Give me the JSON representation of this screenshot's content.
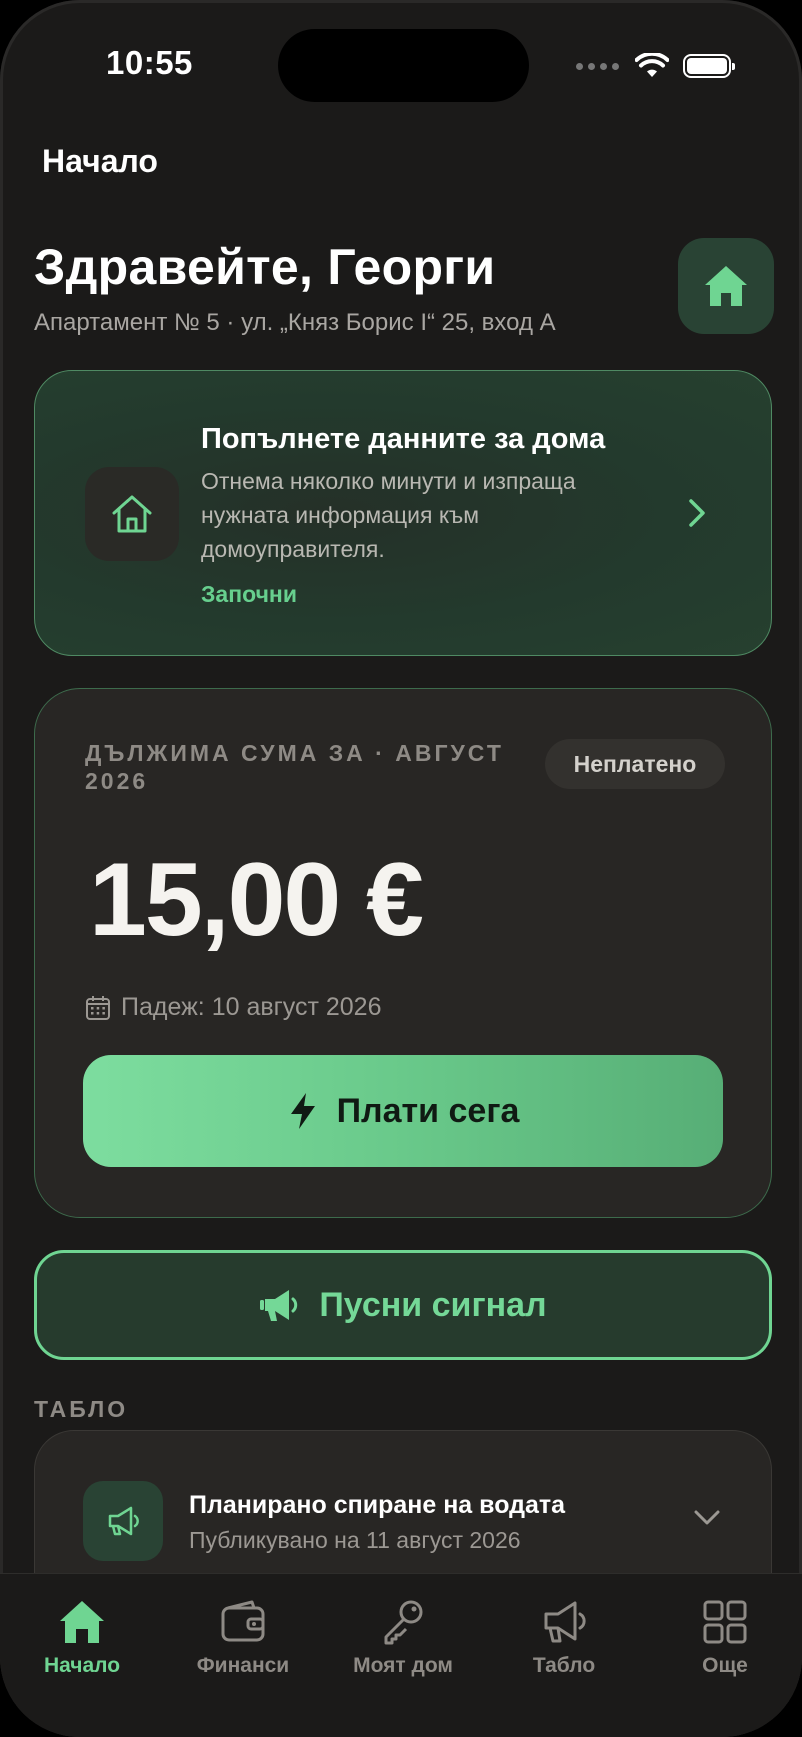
{
  "status_bar": {
    "time": "10:55"
  },
  "nav": {
    "title": "Начало"
  },
  "header": {
    "greeting": "Здравейте, Георги",
    "address": "Апартамент № 5 · ул. „Княз Борис I“ 25, вход А"
  },
  "onboarding": {
    "title": "Попълнете данните за дома",
    "description": "Отнема няколко минути и изпраща нужната информация към домоуправителя.",
    "cta": "Започни"
  },
  "due": {
    "label": "ДЪЛЖИМА СУМА ЗА · АВГУСТ 2026",
    "status": "Неплатено",
    "amount": "15,00 €",
    "due_date": "Падеж: 10 август 2026",
    "pay_button": "Плати сега"
  },
  "signal_button": "Пусни сигнал",
  "board": {
    "section_title": "ТАБЛО",
    "items": [
      {
        "title": "Планирано спиране на водата",
        "subtitle": "Публикувано на 11 август 2026",
        "icon": "megaphone-icon"
      }
    ]
  },
  "tabbar": {
    "items": [
      {
        "label": "Начало",
        "icon": "home-icon",
        "active": true
      },
      {
        "label": "Финанси",
        "icon": "wallet-icon",
        "active": false
      },
      {
        "label": "Моят дом",
        "icon": "key-icon",
        "active": false
      },
      {
        "label": "Табло",
        "icon": "megaphone-icon",
        "active": false
      },
      {
        "label": "Още",
        "icon": "grid-icon",
        "active": false
      }
    ]
  },
  "colors": {
    "accent": "#6fd592",
    "background": "#1b1a19",
    "card": "#282624"
  }
}
